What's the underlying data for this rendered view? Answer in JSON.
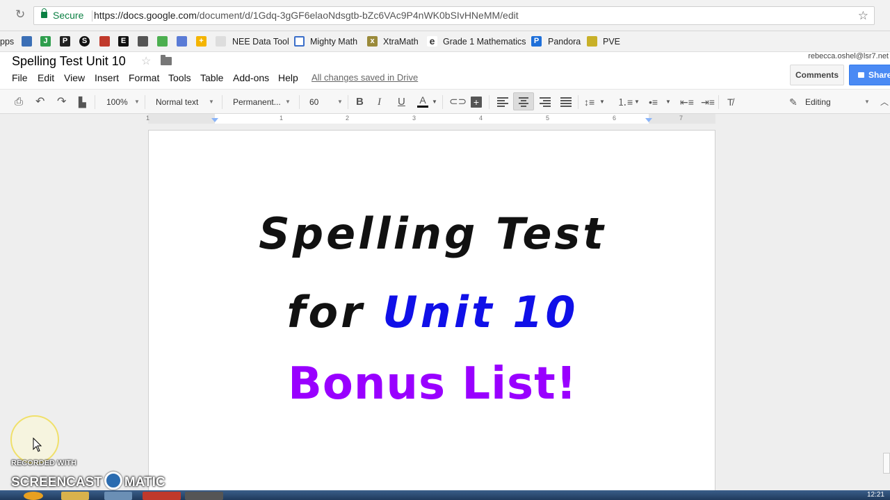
{
  "browser": {
    "secure_label": "Secure",
    "url_host": "https://docs.google.com",
    "url_path": "/document/d/1Gdq-3gGF6elaoNdsgtb-bZc6VAc9P4nWK0bSIvHNeMM/edit"
  },
  "bookmarks": [
    "pps",
    "NEE Data Tool",
    "Mighty Math",
    "XtraMath",
    "Grade 1 Mathematics",
    "Pandora",
    "PVE"
  ],
  "doc": {
    "title": "Spelling Test Unit 10",
    "user_email": "rebecca.oshel@lsr7.net",
    "comments_label": "Comments",
    "share_label": "Share",
    "saved_status": "All changes saved in Drive"
  },
  "menu": [
    "File",
    "Edit",
    "View",
    "Insert",
    "Format",
    "Tools",
    "Table",
    "Add-ons",
    "Help"
  ],
  "toolbar": {
    "zoom": "100%",
    "style": "Normal text",
    "font": "Permanent...",
    "font_size": "60",
    "mode": "Editing"
  },
  "ruler": [
    "1",
    "1",
    "2",
    "3",
    "4",
    "5",
    "6",
    "7"
  ],
  "content": {
    "line1": "Spelling Test",
    "line2_black": "for",
    "line2_blue": "Unit 10",
    "line3": "Bonus List!"
  },
  "watermark": {
    "line1": "RECORDED WITH",
    "line2_left": "SCREENCAST",
    "line2_right": "MATIC"
  },
  "clock": "12:21"
}
